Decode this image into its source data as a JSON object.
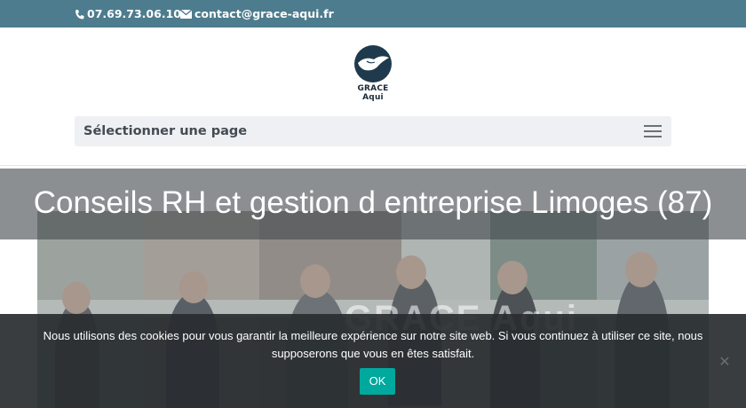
{
  "topbar": {
    "phone": "07.69.73.06.10",
    "email": "contact@grace-aqui.fr"
  },
  "header": {
    "logo_text": "GRACE Aqui",
    "menu_label": "Sélectionner une page"
  },
  "page": {
    "title": "Conseils RH et gestion d entreprise Limoges (87)",
    "banner_watermark": "GRACE Aqui"
  },
  "cookie": {
    "message": "Nous utilisons des cookies pour vous garantir la meilleure expérience sur notre site web. Si vous continuez à utiliser ce site, nous supposerons que vous en êtes satisfait.",
    "ok_label": "OK",
    "close_symbol": "✕"
  },
  "colors": {
    "topbar": "#4d7c8e",
    "accent_button": "#00a99d"
  }
}
